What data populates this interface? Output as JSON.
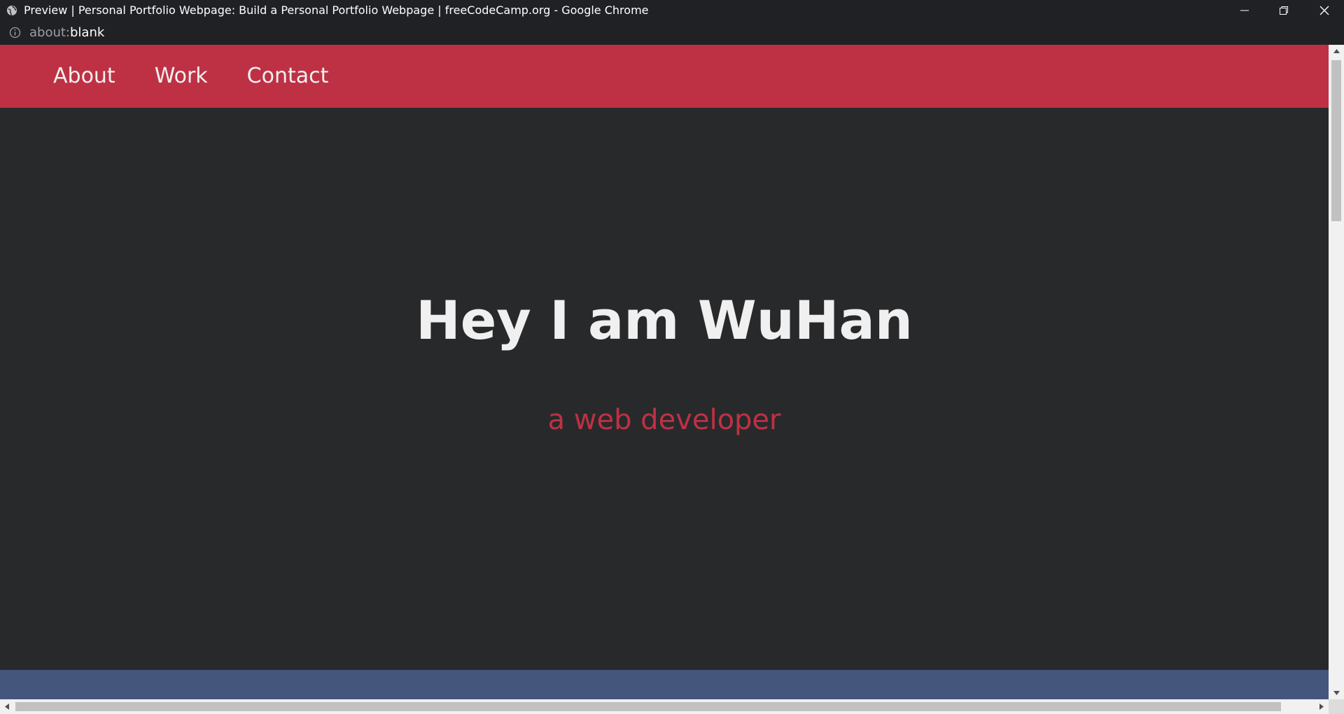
{
  "window": {
    "title": "Preview | Personal Portfolio Webpage: Build a Personal Portfolio Webpage | freeCodeCamp.org - Google Chrome",
    "controls": [
      "minimize-icon",
      "restore-icon",
      "close-icon"
    ]
  },
  "address": {
    "scheme": "about:",
    "path": "blank"
  },
  "nav": {
    "items": [
      {
        "label": "About"
      },
      {
        "label": "Work"
      },
      {
        "label": "Contact"
      }
    ]
  },
  "hero": {
    "title": "Hey I am WuHan",
    "subtitle": "a web developer"
  },
  "colors": {
    "navbar": "#be3144",
    "page_background": "#28292b",
    "next_section": "#45567d",
    "subtitle": "#be3144"
  }
}
